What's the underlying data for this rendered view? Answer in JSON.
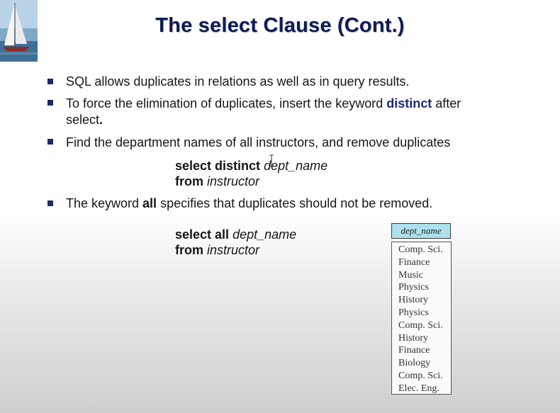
{
  "slide": {
    "title": "The select Clause (Cont.)"
  },
  "bullets": [
    {
      "text": "SQL allows duplicates in relations as well as in query results."
    },
    {
      "pre": "To force the elimination of duplicates, insert the keyword ",
      "keyword": "distinct",
      "post": " after",
      "line2": "select",
      "line2_end": "."
    },
    {
      "text": "Find the department names of all instructors, and remove duplicates"
    },
    {
      "pre": "The keyword ",
      "keyword": "all",
      "post": " specifies that duplicates should not be removed."
    }
  ],
  "query1": {
    "select_kw": "select distinct",
    "select_attr": "dept_name",
    "from_kw": "from",
    "from_rel": "instructor"
  },
  "query2": {
    "select_kw": "select all",
    "select_attr": "dept_name",
    "from_kw": "from",
    "from_rel": "instructor"
  },
  "result_table": {
    "header": "dept_name",
    "rows": [
      "Comp. Sci.",
      "Finance",
      "Music",
      "Physics",
      "History",
      "Physics",
      "Comp. Sci.",
      "History",
      "Finance",
      "Biology",
      "Comp. Sci.",
      "Elec. Eng."
    ]
  },
  "colors": {
    "title": "#0d1a55",
    "keyword": "#1b2a7a",
    "table_header_bg": "#aee1ec"
  }
}
